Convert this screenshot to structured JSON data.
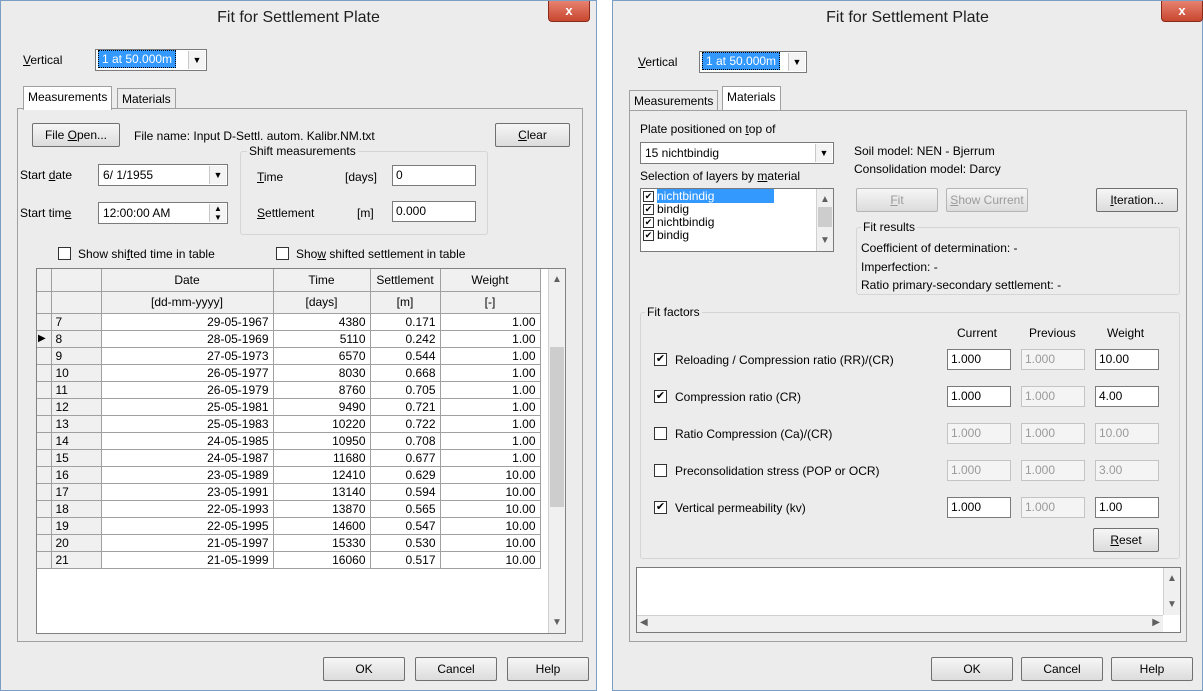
{
  "dialog_title": "Fit for Settlement Plate",
  "close_glyph": "x",
  "vertical_label": "Vertical",
  "vertical_value": "1 at 50.000m",
  "tabs": {
    "measurements": "Measurements",
    "materials": "Materials"
  },
  "buttons": {
    "ok": "OK",
    "cancel": "Cancel",
    "help": "Help"
  },
  "measurements": {
    "file_open": "File Open...",
    "file_name": "File name: Input D-Settl. autom. Kalibr.NM.txt",
    "clear": "Clear",
    "start_date_label": "Start date",
    "start_date_value": "6/ 1/1955",
    "start_time_label": "Start time",
    "start_time_value": "12:00:00 AM",
    "shift_group_title": "Shift measurements",
    "shift_time_label": "Time",
    "shift_time_unit": "[days]",
    "shift_time_value": "0",
    "shift_settlement_label": "Settlement",
    "shift_settlement_unit": "[m]",
    "shift_settlement_value": "0.000",
    "show_shifted_time": "Show shifted time in table",
    "show_shifted_settlement": "Show shifted settlement in table",
    "table": {
      "headers": [
        "Date",
        "Time",
        "Settlement",
        "Weight"
      ],
      "units": [
        "[dd-mm-yyyy]",
        "[days]",
        "[m]",
        "[-]"
      ],
      "current_row_marker": "▶",
      "rows": [
        [
          "7",
          "29-05-1967",
          "4380",
          "0.171",
          "1.00"
        ],
        [
          "8",
          "28-05-1969",
          "5110",
          "0.242",
          "1.00"
        ],
        [
          "9",
          "27-05-1973",
          "6570",
          "0.544",
          "1.00"
        ],
        [
          "10",
          "26-05-1977",
          "8030",
          "0.668",
          "1.00"
        ],
        [
          "11",
          "26-05-1979",
          "8760",
          "0.705",
          "1.00"
        ],
        [
          "12",
          "25-05-1981",
          "9490",
          "0.721",
          "1.00"
        ],
        [
          "13",
          "25-05-1983",
          "10220",
          "0.722",
          "1.00"
        ],
        [
          "14",
          "24-05-1985",
          "10950",
          "0.708",
          "1.00"
        ],
        [
          "15",
          "24-05-1987",
          "11680",
          "0.677",
          "1.00"
        ],
        [
          "16",
          "23-05-1989",
          "12410",
          "0.629",
          "10.00"
        ],
        [
          "17",
          "23-05-1991",
          "13140",
          "0.594",
          "10.00"
        ],
        [
          "18",
          "22-05-1993",
          "13870",
          "0.565",
          "10.00"
        ],
        [
          "19",
          "22-05-1995",
          "14600",
          "0.547",
          "10.00"
        ],
        [
          "20",
          "21-05-1997",
          "15330",
          "0.530",
          "10.00"
        ],
        [
          "21",
          "21-05-1999",
          "16060",
          "0.517",
          "10.00"
        ]
      ]
    }
  },
  "materials": {
    "plate_label": "Plate positioned on top of",
    "plate_value": "15 nichtbindig",
    "layers_label": "Selection of layers by material",
    "layers": [
      {
        "label": "nichtbindig",
        "checked": true,
        "selected": true
      },
      {
        "label": "bindig",
        "checked": true,
        "selected": false
      },
      {
        "label": "nichtbindig",
        "checked": true,
        "selected": false
      },
      {
        "label": "bindig",
        "checked": true,
        "selected": false
      }
    ],
    "soil_model": "Soil model: NEN - Bjerrum",
    "consolidation_model": "Consolidation model: Darcy",
    "fit_button": "Fit",
    "show_current_button": "Show Current",
    "iteration_button": "Iteration...",
    "fit_results_title": "Fit results",
    "coef_determination": "Coefficient of determination: -",
    "imperfection": "Imperfection: -",
    "ratio_primary_secondary": "Ratio primary-secondary settlement: -",
    "fit_factors_title": "Fit factors",
    "col_current": "Current",
    "col_previous": "Previous",
    "col_weight": "Weight",
    "factors": [
      {
        "label": "Reloading / Compression ratio (RR)/(CR)",
        "checked": true,
        "current": "1.000",
        "previous": "1.000",
        "weight": "10.00"
      },
      {
        "label": "Compression ratio (CR)",
        "checked": true,
        "current": "1.000",
        "previous": "1.000",
        "weight": "4.00"
      },
      {
        "label": "Ratio Compression (Ca)/(CR)",
        "checked": false,
        "current": "1.000",
        "previous": "1.000",
        "weight": "10.00"
      },
      {
        "label": "Preconsolidation stress (POP or OCR)",
        "checked": false,
        "current": "1.000",
        "previous": "1.000",
        "weight": "3.00"
      },
      {
        "label": "Vertical permeability (kv)",
        "checked": true,
        "current": "1.000",
        "previous": "1.000",
        "weight": "1.00"
      }
    ],
    "reset_button": "Reset"
  }
}
